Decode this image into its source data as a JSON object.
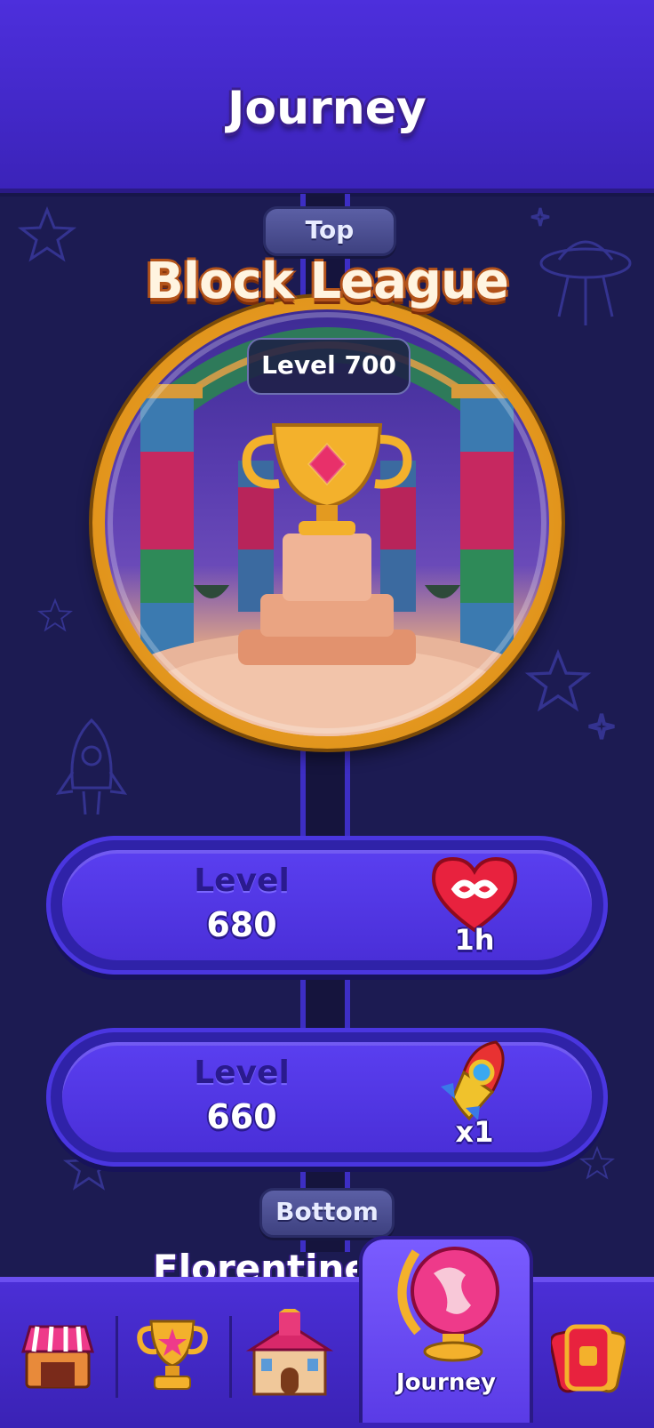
{
  "header": {
    "title": "Journey"
  },
  "top_label": "Top",
  "league": {
    "title": "Block League",
    "level": "Level 700"
  },
  "levels": [
    {
      "word": "Level",
      "number": "680",
      "reward_icon": "infinite-heart-icon",
      "reward_text": "1h"
    },
    {
      "word": "Level",
      "number": "660",
      "reward_icon": "rocket-icon",
      "reward_text": "x1"
    }
  ],
  "bottom_label": "Bottom",
  "next_league_partial": "Florentine",
  "nav": {
    "items": [
      {
        "icon": "shop-icon"
      },
      {
        "icon": "trophy-icon"
      },
      {
        "icon": "castle-icon"
      },
      {
        "icon": "globe-icon",
        "label": "Journey",
        "active": true
      },
      {
        "icon": "cards-icon"
      }
    ]
  },
  "colors": {
    "header": "#4d2fdc",
    "background": "#1c1b52",
    "accent_gold": "#f7b63a",
    "card": "#4a2fd8"
  }
}
